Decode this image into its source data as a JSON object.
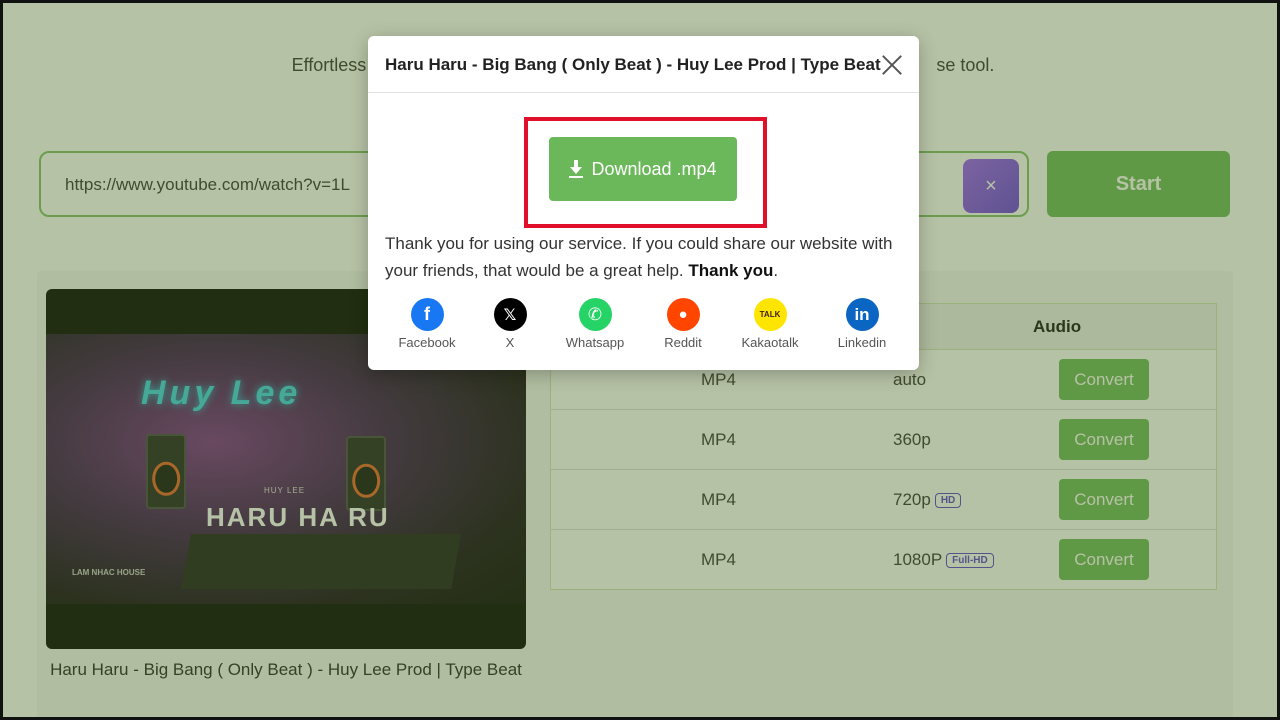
{
  "page": {
    "tagline": "Effortless",
    "tagline_tail": "se tool."
  },
  "search": {
    "url_value": "https://www.youtube.com/watch?v=1L",
    "clear_label": "×",
    "start_label": "Start"
  },
  "video": {
    "thumb_neon": "Huy Lee",
    "thumb_sub": "HUY LEE",
    "thumb_title": "HARU HA RU",
    "thumb_small": "LAM NHAC HOUSE",
    "caption": "Haru Haru - Big Bang ( Only Beat ) - Huy Lee Prod | Type Beat"
  },
  "table": {
    "header_audio": "Audio",
    "rows": [
      {
        "format": "MP4",
        "quality": "auto",
        "badge": "",
        "action": "Convert"
      },
      {
        "format": "MP4",
        "quality": "360p",
        "badge": "",
        "action": "Convert"
      },
      {
        "format": "MP4",
        "quality": "720p",
        "badge": "HD",
        "action": "Convert"
      },
      {
        "format": "MP4",
        "quality": "1080P",
        "badge": "Full-HD",
        "action": "Convert"
      }
    ]
  },
  "modal": {
    "title": "Haru Haru - Big Bang ( Only Beat ) - Huy Lee Prod | Type Beat",
    "download_label": "Download .mp4",
    "thanks_text": "Thank you for using our service. If you could share our website with your friends, that would be a great help.",
    "thanks_bold": "Thank you",
    "thanks_end": ".",
    "share": [
      {
        "label": "Facebook",
        "icon": "facebook-icon",
        "color": "#1877f2",
        "glyph": "f"
      },
      {
        "label": "X",
        "icon": "x-icon",
        "color": "#000000",
        "glyph": "𝕏"
      },
      {
        "label": "Whatsapp",
        "icon": "whatsapp-icon",
        "color": "#25d366",
        "glyph": "✆"
      },
      {
        "label": "Reddit",
        "icon": "reddit-icon",
        "color": "#ff4500",
        "glyph": "●"
      },
      {
        "label": "Kakaotalk",
        "icon": "kakaotalk-icon",
        "color": "#fee500",
        "glyph": "TALK"
      },
      {
        "label": "Linkedin",
        "icon": "linkedin-icon",
        "color": "#0a66c2",
        "glyph": "in"
      }
    ]
  },
  "colors": {
    "accent_green": "#6ab85a",
    "highlight_red": "#e0102a",
    "clear_purple": "#7b4be8"
  }
}
